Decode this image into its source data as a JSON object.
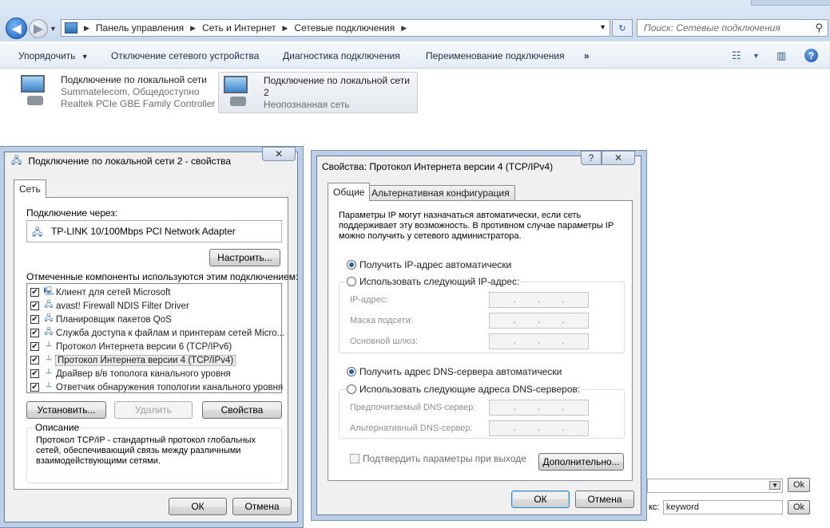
{
  "explorer": {
    "breadcrumbs": [
      "Панель управления",
      "Сеть и Интернет",
      "Сетевые подключения"
    ],
    "search_placeholder": "Поиск: Сетевые подключения",
    "toolbar": {
      "organize": "Упорядочить",
      "disable": "Отключение сетевого устройства",
      "diagnose": "Диагностика подключения",
      "rename": "Переименование подключения",
      "more": "»"
    },
    "connections": [
      {
        "name": "Подключение по локальной сети",
        "status": "Summatelecom, Общедоступно",
        "device": "Realtek PCIe GBE Family Controller"
      },
      {
        "name": "Подключение по локальной сети",
        "name2": "2",
        "status": "Неопознанная сеть"
      }
    ]
  },
  "props_dialog": {
    "title": "Подключение по локальной сети 2 - свойства",
    "tab": "Сеть",
    "connect_using_label": "Подключение через:",
    "adapter": "TP-LINK 10/100Mbps PCI Network Adapter",
    "configure": "Настроить...",
    "components_label": "Отмеченные компоненты используются этим подключением:",
    "components": [
      {
        "label": "Клиент для сетей Microsoft",
        "checked": true,
        "icon": "network-client-icon"
      },
      {
        "label": "avast! Firewall NDIS Filter Driver",
        "checked": true,
        "icon": "network-service-icon"
      },
      {
        "label": "Планировщик пакетов QoS",
        "checked": true,
        "icon": "network-service-icon"
      },
      {
        "label": "Служба доступа к файлам и принтерам сетей Micro...",
        "checked": true,
        "icon": "network-service-icon"
      },
      {
        "label": "Протокол Интернета версии 6 (TCP/IPv6)",
        "checked": true,
        "icon": "protocol-icon"
      },
      {
        "label": "Протокол Интернета версии 4 (TCP/IPv4)",
        "checked": true,
        "icon": "protocol-icon",
        "selected": true
      },
      {
        "label": "Драйвер в/в тополога канального уровня",
        "checked": true,
        "icon": "protocol-icon"
      },
      {
        "label": "Ответчик обнаружения топологии канального уровня",
        "checked": true,
        "icon": "protocol-icon"
      }
    ],
    "install": "Установить...",
    "uninstall": "Удалить",
    "properties": "Свойства",
    "description_title": "Описание",
    "description": "Протокол TCP/IP - стандартный протокол глобальных сетей, обеспечивающий связь между различными взаимодействующими сетями.",
    "ok": "ОК",
    "cancel": "Отмена"
  },
  "ipv4_dialog": {
    "title": "Свойства: Протокол Интернета версии 4 (TCP/IPv4)",
    "help": "?",
    "tab_general": "Общие",
    "tab_alt": "Альтернативная конфигурация",
    "intro": "Параметры IP могут назначаться автоматически, если сеть поддерживает эту возможность. В противном случае параметры IP можно получить у сетевого администратора.",
    "ip_auto": "Получить IP-адрес автоматически",
    "ip_manual": "Использовать следующий IP-адрес:",
    "ip_label": "IP-адрес:",
    "mask_label": "Маска подсети:",
    "gateway_label": "Основной шлюз:",
    "dns_auto": "Получить адрес DNS-сервера автоматически",
    "dns_manual": "Использовать следующие адреса DNS-серверов:",
    "dns_pref_label": "Предпочитаемый DNS-сервер:",
    "dns_alt_label": "Альтернативный DNS-сервер:",
    "validate": "Подтвердить параметры при выходе",
    "advanced": "Дополнительно...",
    "ok": "ОК",
    "cancel": "Отмена",
    "ip_dot": "."
  },
  "background": {
    "ok1": "Ok",
    "ok2": "Ok",
    "keyword_label": "кс:",
    "keyword_value": "keyword"
  }
}
